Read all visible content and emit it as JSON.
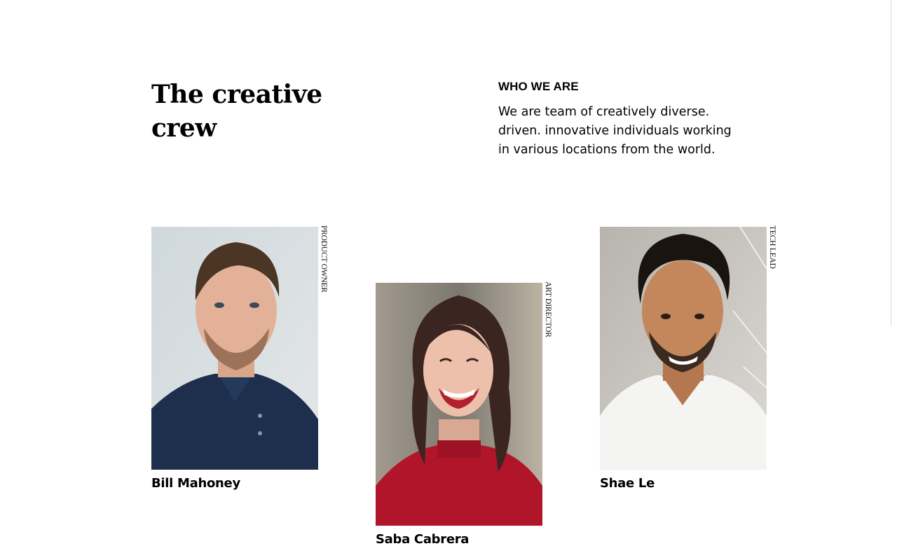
{
  "header": {
    "title": "The creative crew",
    "eyebrow": "WHO WE ARE",
    "description": "We are team of creatively diverse. driven. innovative individuals working in various locations from the world."
  },
  "team": [
    {
      "name": "Bill Mahoney",
      "role": "PRODUCT OWNER"
    },
    {
      "name": "Saba Cabrera",
      "role": "ART DIRECTOR"
    },
    {
      "name": "Shae Le",
      "role": "TECH LEAD"
    }
  ],
  "colors": {
    "text": "#000000",
    "background": "#ffffff"
  }
}
